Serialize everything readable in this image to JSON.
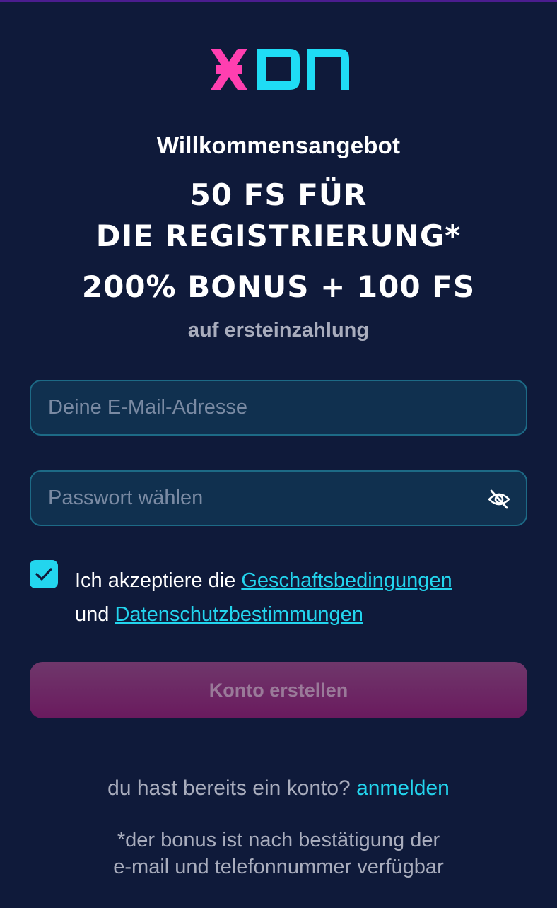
{
  "brand": {
    "logo_icon": "xon-logo",
    "colors": {
      "x_pink": "#ff3fb0",
      "on_cyan": "#1fdcf5",
      "background": "#0f1a3a",
      "accent": "#23d5ee"
    }
  },
  "offer": {
    "welcome": "Willkommensangebot",
    "line1": "50 FS FÜR",
    "line2": "DIE REGISTRIERUNG*",
    "line3": "200% BONUS + 100 FS",
    "subline": "auf ersteinzahlung"
  },
  "form": {
    "email_placeholder": "Deine E-Mail-Adresse",
    "email_value": "",
    "password_placeholder": "Passwort wählen",
    "password_value": "",
    "password_toggle_icon": "eye-off-icon",
    "consent_checked": true,
    "consent_prefix": "Ich akzeptiere die ",
    "terms_link": "Geschaftsbedingungen",
    "consent_and": "und ",
    "privacy_link": "Datenschutzbestimmungen",
    "submit_label": "Konto erstellen"
  },
  "footer": {
    "have_account": "du hast bereits ein konto? ",
    "login_link": "anmelden",
    "note_line1": "*der bonus ist nach bestätigung der",
    "note_line2": "e-mail und telefonnummer verfügbar"
  }
}
